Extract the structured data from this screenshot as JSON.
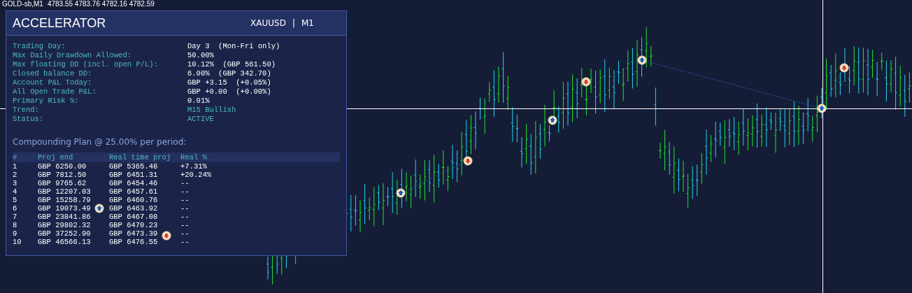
{
  "chart_header": {
    "symbol": "GOLD-sb,M1",
    "quotes": "4783.55 4783.76 4782.16 4782.59"
  },
  "panel": {
    "title": "ACCELERATOR",
    "symbol": "XAUUSD",
    "separator": "|",
    "timeframe": "M1",
    "stats": [
      {
        "label": "Trading Day:",
        "value": "Day 3  (Mon-Fri only)",
        "kind": "plain"
      },
      {
        "label": "Max Daily Drawdown Allowed:",
        "value": "50.00%",
        "kind": "plain"
      },
      {
        "label": "Max floating DD (incl. open P/L):",
        "value": "10.12%  (GBP 561.50)",
        "kind": "plain"
      },
      {
        "label": "Closed balance DD:",
        "value": "6.00%  (GBP 342.70)",
        "kind": "plain"
      },
      {
        "label": "Account P&L Today:",
        "value": "GBP +3.15  (+0.05%)",
        "kind": "plain"
      },
      {
        "label": "All Open Trade P&L:",
        "value": "GBP +0.00  (+0.00%)",
        "kind": "plain"
      },
      {
        "label": "Primary Risk %:",
        "value": "0.01%",
        "kind": "plain"
      },
      {
        "label": "Trend:",
        "value": "M15 Bullish",
        "kind": "accent"
      },
      {
        "label": "Status:",
        "value": "ACTIVE",
        "kind": "accent"
      }
    ],
    "plan_title": "Compounding Plan @ 25.00% per period:",
    "plan_columns": [
      "#",
      "Proj end",
      "Real time proj",
      "Real %"
    ],
    "plan_rows": [
      [
        "1",
        "GBP 6250.00",
        "GBP 5365.48",
        "+7.31%"
      ],
      [
        "2",
        "GBP 7812.50",
        "GBP 6451.31",
        "+20.24%"
      ],
      [
        "3",
        "GBP 9765.62",
        "GBP 6454.46",
        "--"
      ],
      [
        "4",
        "GBP 12207.03",
        "GBP 6457.61",
        "--"
      ],
      [
        "5",
        "GBP 15258.79",
        "GBP 6460.76",
        "--"
      ],
      [
        "6",
        "GBP 19073.49",
        "GBP 6463.92",
        "--"
      ],
      [
        "7",
        "GBP 23841.86",
        "GBP 6467.08",
        "--"
      ],
      [
        "8",
        "GBP 29802.32",
        "GBP 6470.23",
        "--"
      ],
      [
        "9",
        "GBP 37252.90",
        "GBP 6473.39",
        "--"
      ],
      [
        "10",
        "GBP 46566.13",
        "GBP 6476.55",
        "--"
      ]
    ]
  }
}
